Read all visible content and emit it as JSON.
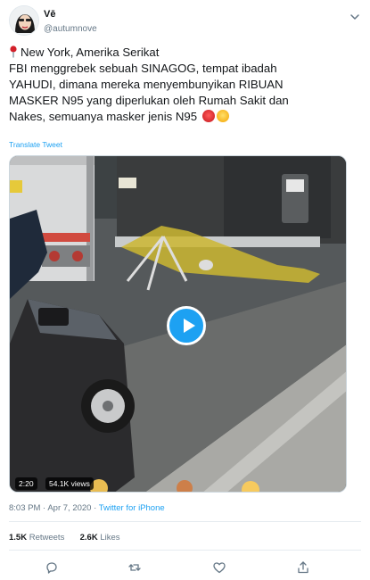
{
  "tweet": {
    "display_name": "Vē",
    "handle": "@autumnove",
    "location_icon": "round-pushpin-icon",
    "lines": [
      "New York, Amerika Serikat",
      "FBI menggrebek sebuah SINAGOG, tempat ibadah",
      "YAHUDI, dimana mereka menyembunyikan RIBUAN",
      "MASKER N95 yang diperlukan oleh Rumah Sakit dan",
      "Nakes, semuanya masker jenis N95"
    ],
    "end_emojis": [
      "angry-face-icon",
      "exploding-head-icon"
    ],
    "translate_label": "Translate Tweet",
    "video": {
      "duration": "2:20",
      "views": "54.1K views",
      "play_icon": "play-icon"
    },
    "time": "8:03 PM",
    "date": "Apr 7, 2020",
    "separator": "·",
    "source": "Twitter for iPhone",
    "retweets_count": "1.5K",
    "retweets_label": "Retweets",
    "likes_count": "2.6K",
    "likes_label": "Likes"
  },
  "colors": {
    "accent": "#1da1f2",
    "text": "#14171a",
    "muted": "#657786",
    "divider": "#e6ecf0"
  },
  "icons": {
    "more": "chevron-down-icon",
    "reply": "reply-icon",
    "retweet": "retweet-icon",
    "like": "heart-icon",
    "share": "share-icon"
  }
}
